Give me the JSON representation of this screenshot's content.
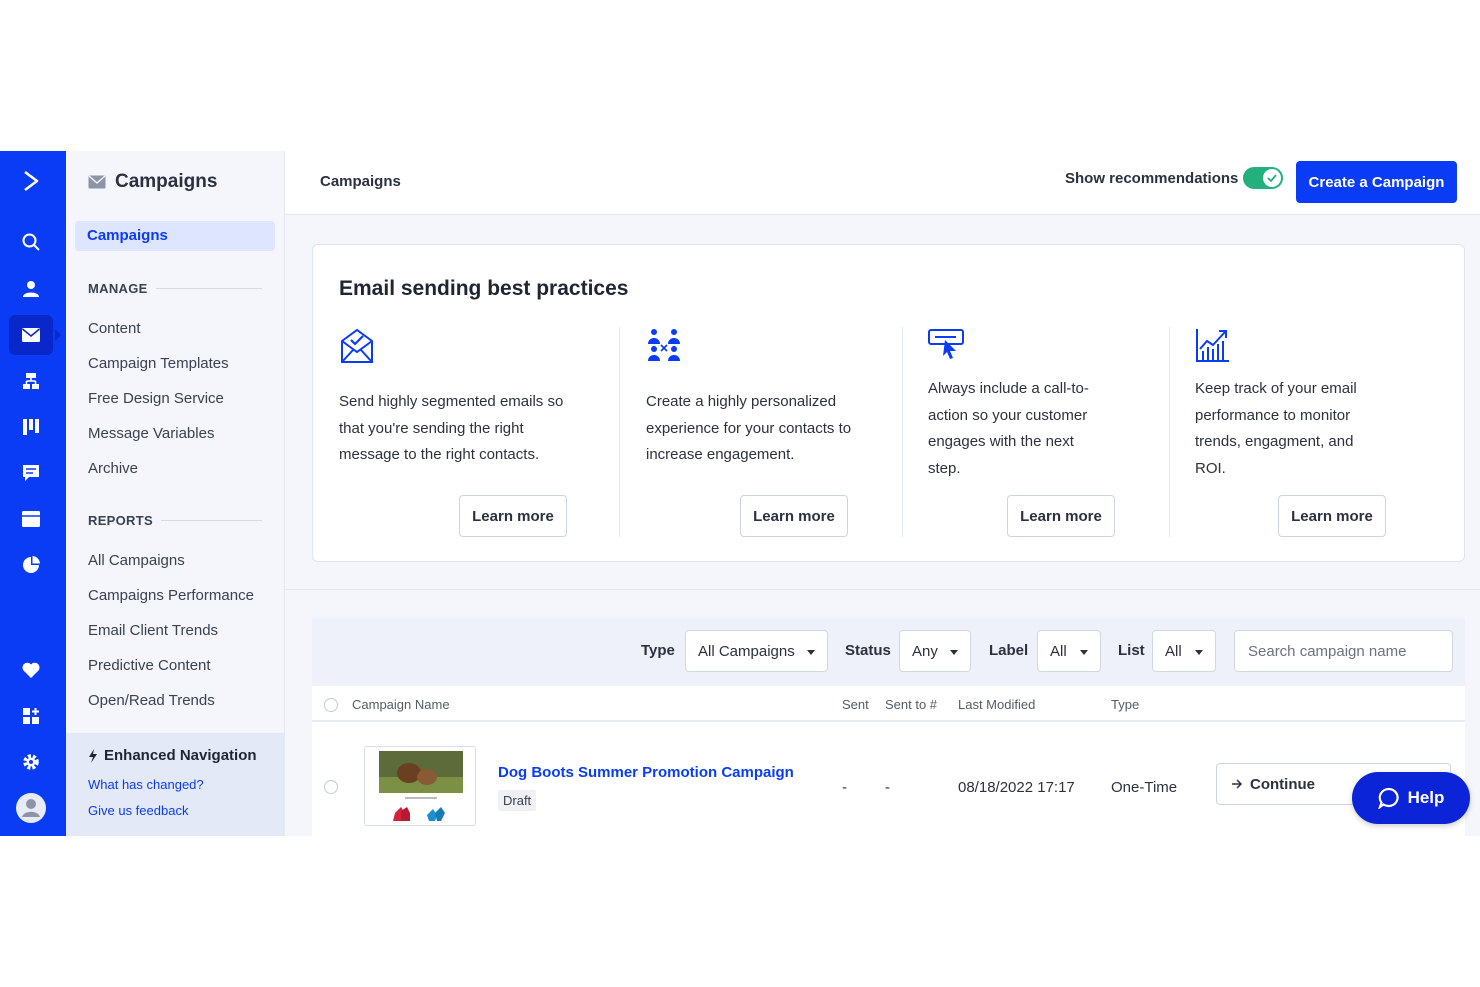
{
  "subnav": {
    "title": "Campaigns",
    "active_item": "Campaigns",
    "manage_label": "MANAGE",
    "manage_items": [
      "Content",
      "Campaign Templates",
      "Free Design Service",
      "Message Variables",
      "Archive"
    ],
    "reports_label": "REPORTS",
    "reports_items": [
      "All Campaigns",
      "Campaigns Performance",
      "Email Client Trends",
      "Predictive Content",
      "Open/Read Trends"
    ],
    "enhanced_title": "Enhanced Navigation",
    "enhanced_link_1": "What has changed?",
    "enhanced_link_2": "Give us feedback"
  },
  "topbar": {
    "title": "Campaigns",
    "show_recommendations": "Show recommendations",
    "recommendations_on": true,
    "create_button": "Create a Campaign"
  },
  "best_practices": {
    "title": "Email sending best practices",
    "tips": [
      {
        "icon": "envelope-check-icon",
        "text": "Send highly segmented emails so that you're sending the right message to the right contacts.",
        "button": "Learn more"
      },
      {
        "icon": "people-group-icon",
        "text": "Create a highly personalized experience for your contacts to increase engagement.",
        "button": "Learn more"
      },
      {
        "icon": "cursor-click-icon",
        "text": "Always include a call-to-action so your customer engages with the next step.",
        "button": "Learn more"
      },
      {
        "icon": "chart-growth-icon",
        "text": "Keep track of your email performance to monitor trends, engagment, and ROI.",
        "button": "Learn more"
      }
    ]
  },
  "filters": {
    "type_label": "Type",
    "type_value": "All Campaigns",
    "status_label": "Status",
    "status_value": "Any",
    "label_label": "Label",
    "label_value": "All",
    "list_label": "List",
    "list_value": "All",
    "search_placeholder": "Search campaign name"
  },
  "table": {
    "columns": [
      "Campaign Name",
      "Sent",
      "Sent to #",
      "Last Modified",
      "Type"
    ],
    "rows": [
      {
        "name": "Dog Boots Summer Promotion Campaign",
        "status": "Draft",
        "sent": "-",
        "sent_to": "-",
        "last_modified": "08/18/2022 17:17",
        "type": "One-Time",
        "action": "Continue"
      }
    ]
  },
  "help": {
    "label": "Help"
  },
  "colors": {
    "brand": "#0b3cf5",
    "toggle_on": "#23b07d"
  }
}
